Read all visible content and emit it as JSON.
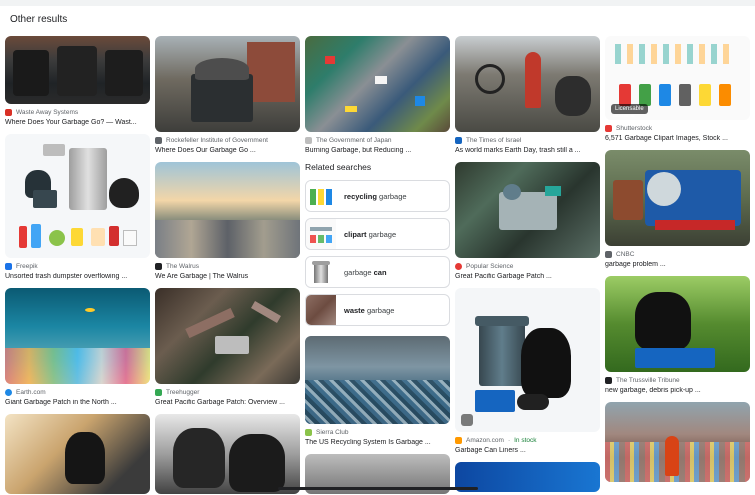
{
  "heading": "Other results",
  "colors": {
    "accent": "#1a73e8",
    "in_stock": "#188038",
    "text": "#202124",
    "muted": "#5f6368"
  },
  "col1": [
    {
      "source": "Waste Away Systems",
      "title": "Where Does Your Garbage Go? — Wast...",
      "favicon": "#d93025"
    },
    {
      "source": "Freepik",
      "title": "Unsorted trash dumpster overflowing ...",
      "favicon": "#1a73e8"
    },
    {
      "source": "Earth.com",
      "title": "Giant Garbage Patch in the North ...",
      "favicon": "#1e88e5"
    }
  ],
  "col2": [
    {
      "source": "Rockefeller Institute of Government",
      "title": "Where Does Our Garbage Go ...",
      "favicon": "#5f6368"
    },
    {
      "source": "The Walrus",
      "title": "We Are Garbage | The Walrus",
      "favicon": "#202124"
    },
    {
      "source": "Treehugger",
      "title": "Great Pacific Garbage Patch: Overview ...",
      "favicon": "#34a853"
    }
  ],
  "col3": {
    "top": {
      "source": "The Government of Japan",
      "title": "Burning Garbage, but Reducing ...",
      "favicon": "#bdbdbd"
    },
    "related_title": "Related searches",
    "related": [
      {
        "bold": "recycling",
        "rest": " garbage"
      },
      {
        "bold": "clipart",
        "rest": " garbage"
      },
      {
        "bold": "garbage",
        "rest": " can",
        "bold_last": true
      },
      {
        "bold": "waste",
        "rest": " garbage"
      }
    ],
    "bottom": {
      "source": "Sierra Club",
      "title": "The US Recycling System Is Garbage ...",
      "favicon": "#8bc34a"
    }
  },
  "col4": [
    {
      "source": "The Times of Israel",
      "title": "As world marks Earth Day, trash still a ...",
      "favicon": "#1565c0"
    },
    {
      "source": "Popular Science",
      "title": "Great Pacific Garbage Patch ...",
      "favicon": "#e53935"
    },
    {
      "source": "Amazon.com",
      "stock": "In stock",
      "title": "Garbage Can Liners ...",
      "favicon": "#ff9900"
    }
  ],
  "col5": [
    {
      "source": "Shutterstock",
      "title": "6,571 Garbage Clipart Images, Stock ...",
      "favicon": "#e53935",
      "badge": "Licensable",
      "watermark": "shutterstock"
    },
    {
      "source": "CNBC",
      "title": "garbage problem ...",
      "favicon": "#5f6368"
    },
    {
      "source": "The Trussville Tribune",
      "title": "new garbage, debris pick-up ...",
      "favicon": "#202124"
    }
  ]
}
